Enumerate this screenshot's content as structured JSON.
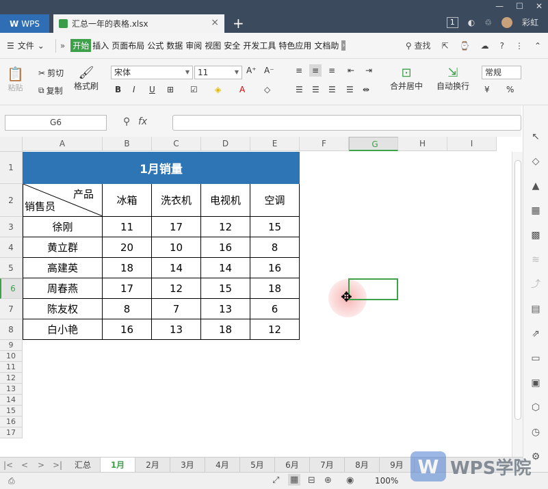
{
  "tabs": {
    "app": "WPS",
    "doc": "汇总一年的表格.xlsx",
    "plus": "+",
    "close": "×"
  },
  "window": {
    "count": "1",
    "user": "彩虹"
  },
  "menu": {
    "file": "文件",
    "items": [
      "开始",
      "插入",
      "页面布局",
      "公式",
      "数据",
      "审阅",
      "视图",
      "安全",
      "开发工具",
      "特色应用",
      "文档助"
    ],
    "search": "查找"
  },
  "toolbar": {
    "paste": "粘贴",
    "cut": "剪切",
    "copy": "复制",
    "format_painter": "格式刷",
    "font": "宋体",
    "size": "11",
    "merge": "合并居中",
    "wrap": "自动换行",
    "number_format": "常规"
  },
  "formula": {
    "cell_ref": "G6",
    "fx": "fx",
    "value": ""
  },
  "columns": [
    "A",
    "B",
    "C",
    "D",
    "E",
    "F",
    "G",
    "H",
    "I"
  ],
  "rows": [
    "1",
    "2",
    "3",
    "4",
    "5",
    "6",
    "7",
    "8",
    "9",
    "10",
    "11",
    "12",
    "13",
    "14",
    "15",
    "16",
    "17"
  ],
  "sheet": {
    "title": "1月销量",
    "header_top": "产品",
    "header_bottom": "销售员",
    "products": [
      "冰箱",
      "洗衣机",
      "电视机",
      "空调"
    ],
    "data": [
      {
        "name": "徐刚",
        "values": [
          "11",
          "17",
          "12",
          "15"
        ]
      },
      {
        "name": "黄立群",
        "values": [
          "20",
          "10",
          "16",
          "8"
        ]
      },
      {
        "name": "高建英",
        "values": [
          "18",
          "14",
          "14",
          "16"
        ]
      },
      {
        "name": "周春燕",
        "values": [
          "17",
          "12",
          "15",
          "18"
        ]
      },
      {
        "name": "陈友权",
        "values": [
          "8",
          "7",
          "13",
          "6"
        ]
      },
      {
        "name": "白小艳",
        "values": [
          "16",
          "13",
          "18",
          "12"
        ]
      }
    ]
  },
  "sheet_tabs": [
    "汇总",
    "1月",
    "2月",
    "3月",
    "4月",
    "5月",
    "6月",
    "7月",
    "8月",
    "9月"
  ],
  "active_sheet": "1月",
  "status": {
    "zoom": "100%"
  },
  "watermark": "WPS学院"
}
